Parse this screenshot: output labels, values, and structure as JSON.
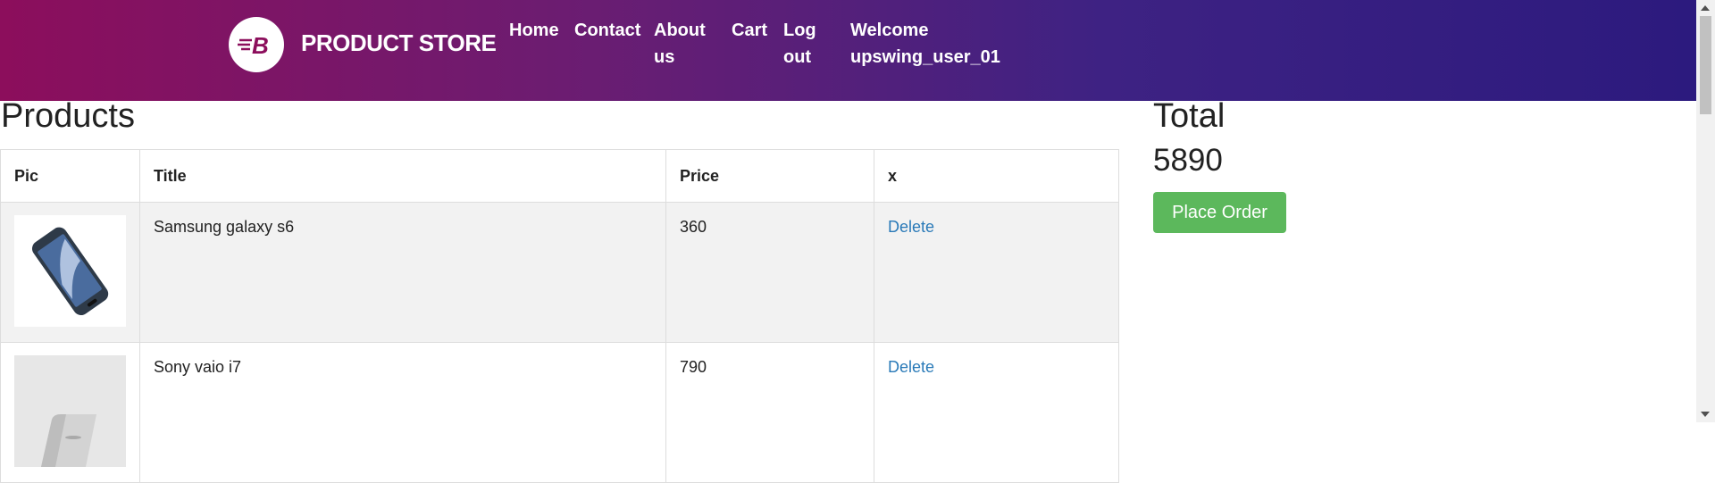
{
  "brand": {
    "name": "PRODUCT STORE",
    "logo_letter": "B"
  },
  "nav": {
    "home": "Home",
    "contact": "Contact",
    "about": "About us",
    "cart": "Cart",
    "logout": "Log out",
    "welcome": "Welcome upswing_user_01"
  },
  "products": {
    "heading": "Products",
    "columns": {
      "pic": "Pic",
      "title": "Title",
      "price": "Price",
      "x": "x"
    },
    "rows": [
      {
        "title": "Samsung galaxy s6",
        "price": "360",
        "action": "Delete",
        "image_icon": "phone-image"
      },
      {
        "title": "Sony vaio i7",
        "price": "790",
        "action": "Delete",
        "image_icon": "laptop-image"
      }
    ]
  },
  "total": {
    "heading": "Total",
    "value": "5890"
  },
  "order": {
    "button_label": "Place Order"
  },
  "colors": {
    "nav_gradient_start": "#8c0e5c",
    "nav_gradient_end": "#2c1a7e",
    "button_green": "#5cb85c",
    "link_blue": "#2a7ab8",
    "row_stripe": "#f2f2f2"
  }
}
